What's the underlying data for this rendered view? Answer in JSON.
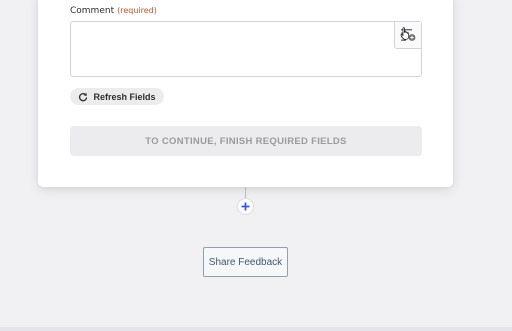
{
  "form": {
    "comment_label": "Comment",
    "required_tag": "(required)",
    "comment_value": "",
    "insert_data_icon": "list-plus-icon",
    "refresh_label": "Refresh Fields",
    "refresh_icon": "refresh-icon",
    "continue_label": "TO CONTINUE, FINISH REQUIRED FIELDS"
  },
  "flow": {
    "add_step_icon": "plus-icon"
  },
  "footer": {
    "feedback_label": "Share Feedback"
  },
  "colors": {
    "background": "#f1f1f4",
    "required_text": "#c1542d",
    "add_icon": "#3b5bdb",
    "feedback_border": "#8ea0b2",
    "feedback_text": "#3f5870"
  }
}
